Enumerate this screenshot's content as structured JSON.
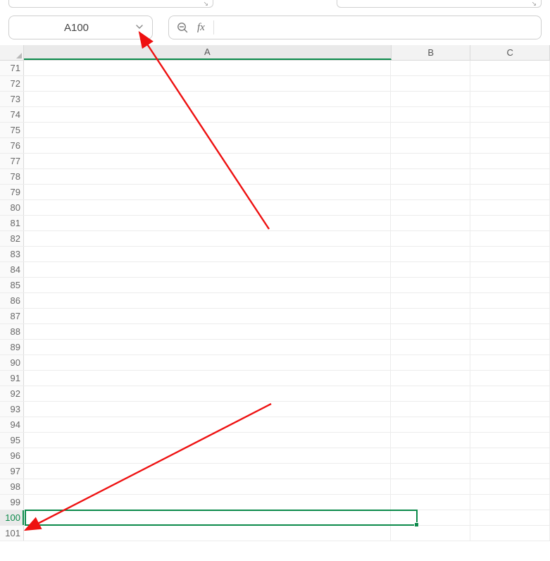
{
  "name_box": {
    "value": "A100"
  },
  "formula_bar": {
    "value": "",
    "placeholder": ""
  },
  "columns": [
    {
      "id": "A",
      "label": "A",
      "selected": true
    },
    {
      "id": "B",
      "label": "B",
      "selected": false
    },
    {
      "id": "C",
      "label": "C",
      "selected": false
    }
  ],
  "row_start": 71,
  "row_end": 101,
  "selected_cell": {
    "col": "A",
    "row": 100
  },
  "cells": {}
}
